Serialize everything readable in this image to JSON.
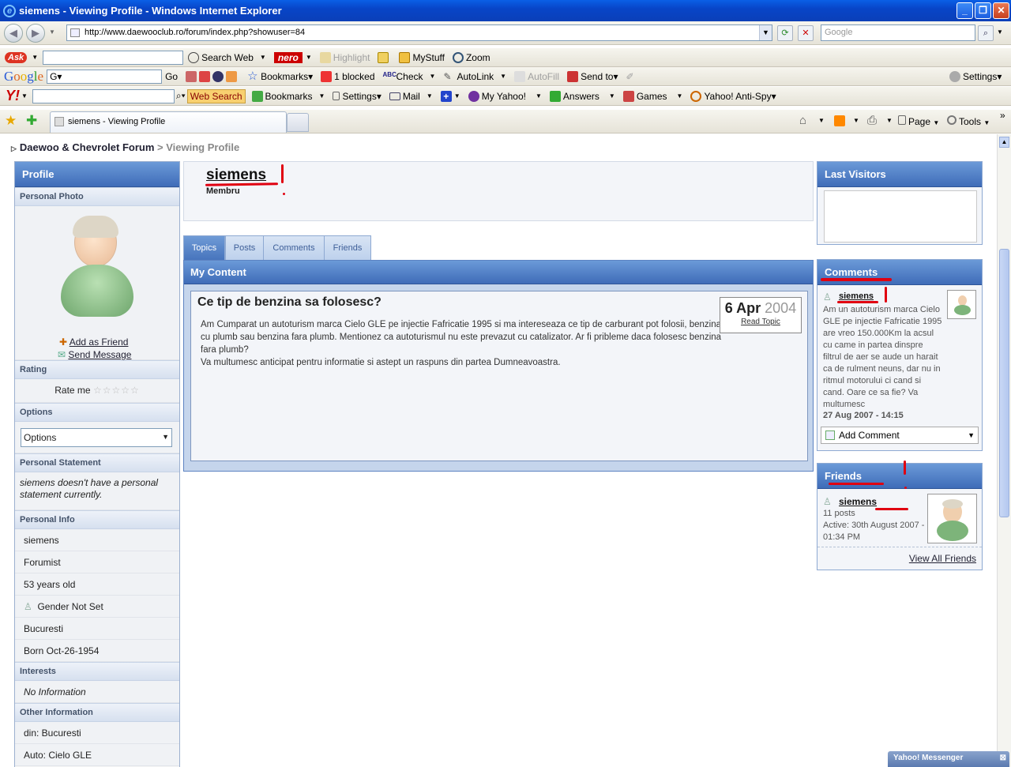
{
  "window": {
    "title": "siemens - Viewing Profile - Windows Internet Explorer"
  },
  "address": {
    "url": "http://www.daewooclub.ro/forum/index.php?showuser=84",
    "search_placeholder": "Google"
  },
  "toolbars": {
    "ask": [
      "Search Web",
      "Highlight",
      "MyStuff",
      "Zoom"
    ],
    "google": [
      "Go",
      "Bookmarks",
      "1 blocked",
      "Check",
      "AutoLink",
      "AutoFill",
      "Send to",
      "Settings"
    ],
    "yahoo": [
      "Web Search",
      "Bookmarks",
      "Settings",
      "Mail",
      "My Yahoo!",
      "Answers",
      "Games",
      "Yahoo! Anti-Spy"
    ]
  },
  "tab": {
    "label": "siemens - Viewing Profile",
    "page_label": "Page",
    "tools_label": "Tools"
  },
  "breadcrumb": {
    "forum": "Daewoo & Chevrolet Forum",
    "sep": ">",
    "current": "Viewing Profile"
  },
  "left": {
    "header": "Profile",
    "personal_photo": "Personal Photo",
    "add_friend": "Add as Friend",
    "send_message": "Send Message",
    "rating_label": "Rating",
    "rate_me": "Rate me",
    "options_label": "Options",
    "options_value": "Options",
    "statement_label": "Personal Statement",
    "statement": "siemens doesn't have a personal statement currently.",
    "info_label": "Personal Info",
    "info": [
      "siemens",
      "Forumist",
      "53 years old",
      "Gender Not Set",
      "Bucuresti",
      "Born Oct-26-1954"
    ],
    "interests_label": "Interests",
    "interests": "No Information",
    "other_label": "Other Information",
    "other": [
      "din: Bucuresti",
      "Auto: Cielo GLE"
    ]
  },
  "profile": {
    "name": "siemens",
    "role": "Membru"
  },
  "tabs": [
    "Topics",
    "Posts",
    "Comments",
    "Friends"
  ],
  "content": {
    "header": "My Content",
    "topic_title": "Ce tip de benzina sa folosesc?",
    "topic_body_1": "Am Cumparat un autoturism marca Cielo GLE pe injectie Fafricatie 1995 si ma intereseaza ce tip de carburant pot folosii, benzina cu plumb sau benzina fara plumb. Mentionez ca autoturismul nu este prevazut cu catalizator. Ar fi pribleme daca folosesc benzina fara plumb?",
    "topic_body_2": "Va multumesc anticipat pentru informatie si astept un raspuns din partea Dumneavoastra.",
    "date_day": "6 Apr",
    "date_year": "2004",
    "read_topic": "Read Topic"
  },
  "last_visitors": {
    "header": "Last Visitors"
  },
  "comments": {
    "header": "Comments",
    "user": "siemens",
    "text": "Am un autoturism marca Cielo GLE pe injectie Fafricatie 1995 are vreo 150.000Km la acsul cu came in partea dinspre filtrul de aer se aude un harait ca de rulment neuns, dar nu in ritmul motorului ci cand si cand. Oare ce sa fie? Va multumesc",
    "date": "27 Aug 2007 - 14:15",
    "add": "Add Comment"
  },
  "friends": {
    "header": "Friends",
    "user": "siemens",
    "posts": "11 posts",
    "active": "Active: 30th August 2007 - 01:34 PM",
    "view_all": "View All Friends"
  },
  "messenger": "Yahoo! Messenger",
  "colors": {
    "header_blue": "#4673bc",
    "annotation_red": "#e00010"
  }
}
